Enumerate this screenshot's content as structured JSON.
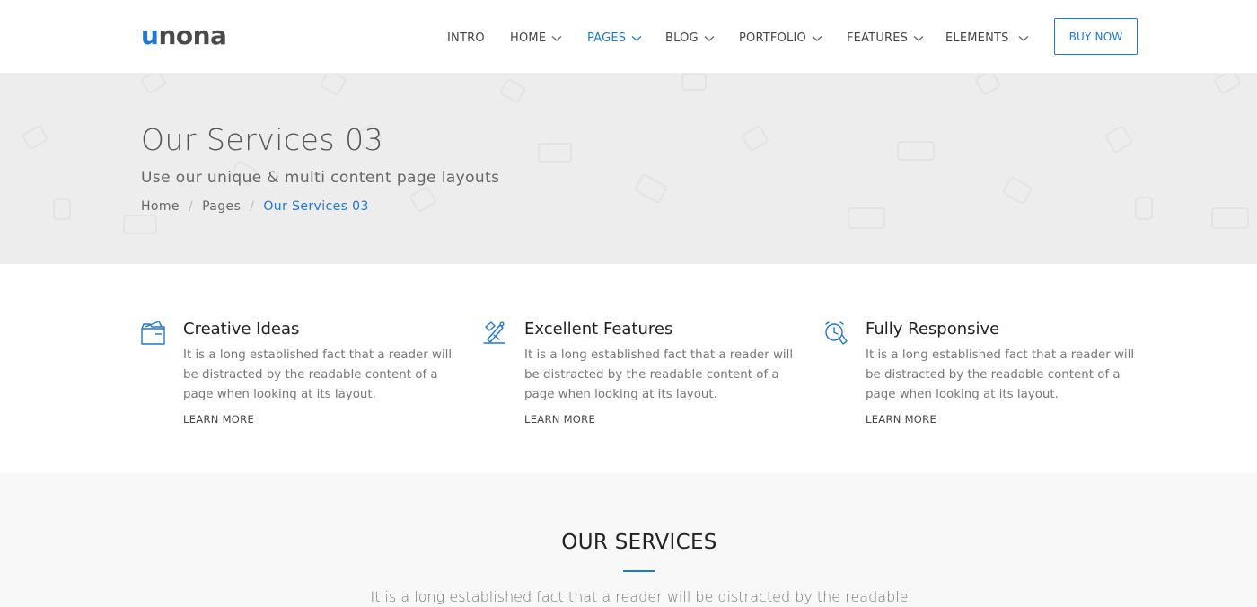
{
  "header": {
    "logo_first": "u",
    "logo_rest": "nona",
    "nav": [
      {
        "label": "INTRO",
        "has_dropdown": false,
        "active": false
      },
      {
        "label": "HOME",
        "has_dropdown": true,
        "active": false
      },
      {
        "label": "PAGES",
        "has_dropdown": true,
        "active": true
      },
      {
        "label": "BLOG",
        "has_dropdown": true,
        "active": false
      },
      {
        "label": "PORTFOLIO",
        "has_dropdown": true,
        "active": false
      },
      {
        "label": "FEATURES",
        "has_dropdown": true,
        "active": false
      },
      {
        "label": "ELEMENTS",
        "has_dropdown": true,
        "active": false
      }
    ],
    "buy_label": "BUY NOW"
  },
  "hero": {
    "title": "Our Services 03",
    "subtitle": "Use our unique & multi content page layouts",
    "breadcrumb": [
      "Home",
      "Pages",
      "Our Services 03"
    ]
  },
  "features": [
    {
      "icon": "folder-icon",
      "title": "Creative Ideas",
      "text": "It is a long established fact that a reader will be distracted by the readable content of a page when looking at its layout.",
      "link": "LEARN MORE"
    },
    {
      "icon": "design-tools-icon",
      "title": "Excellent Features",
      "text": "It is a long established fact that a reader will be distracted by the readable content of a page when looking at its layout.",
      "link": "LEARN MORE"
    },
    {
      "icon": "responsive-devices-icon",
      "title": "Fully Responsive",
      "text": "It is a long established fact that a reader will be distracted by the readable content of a page when looking at its layout.",
      "link": "LEARN MORE"
    }
  ],
  "services": {
    "title": "OUR SERVICES",
    "text": "It is a long established fact that a reader will be distracted by the readable"
  },
  "colors": {
    "accent": "#1f78d1",
    "hero_bg": "#ededed",
    "section_bg": "#f8f8f8"
  }
}
